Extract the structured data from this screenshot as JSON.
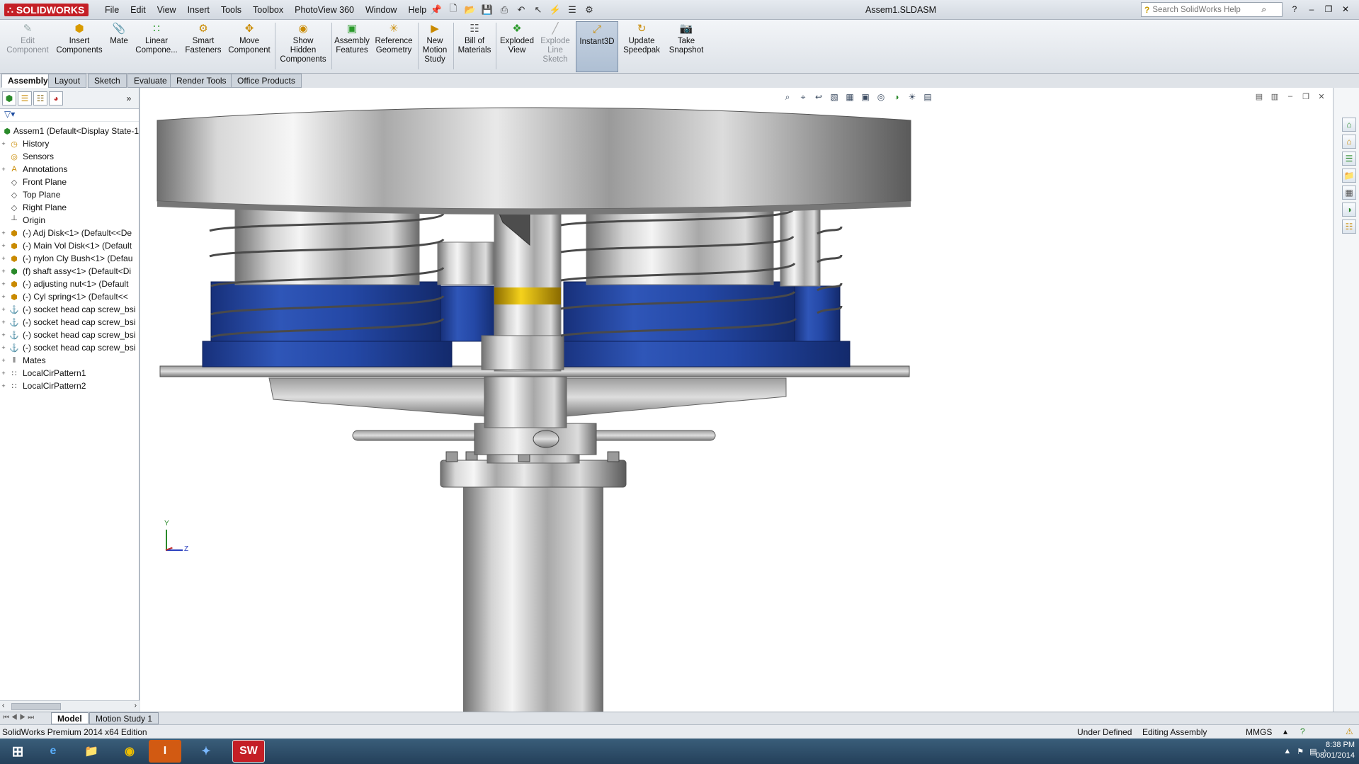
{
  "app": {
    "logo_text": "SOLIDWORKS",
    "document_title": "Assem1.SLDASM"
  },
  "menu": [
    "File",
    "Edit",
    "View",
    "Insert",
    "Tools",
    "Toolbox",
    "PhotoView 360",
    "Window",
    "Help"
  ],
  "search": {
    "placeholder": "Search SolidWorks Help"
  },
  "command_manager": {
    "edit_component": "Edit\nComponent",
    "insert_components": "Insert\nComponents",
    "mate": "Mate",
    "linear_component": "Linear\nCompone...",
    "smart_fasteners": "Smart\nFasteners",
    "move_component": "Move\nComponent",
    "show_hidden": "Show\nHidden\nComponents",
    "assembly_features": "Assembly\nFeatures",
    "reference_geometry": "Reference\nGeometry",
    "new_motion_study": "New\nMotion\nStudy",
    "bill_of_materials": "Bill of\nMaterials",
    "exploded_view": "Exploded\nView",
    "explode_line_sketch": "Explode\nLine\nSketch",
    "instant3d": "Instant3D",
    "update_speedpak": "Update\nSpeedpak",
    "take_snapshot": "Take\nSnapshot"
  },
  "tabs": [
    "Assembly",
    "Layout",
    "Sketch",
    "Evaluate",
    "Render Tools",
    "Office Products"
  ],
  "tree": [
    {
      "label": "Assem1  (Default<Display State-1",
      "icon": "assembly-icon",
      "exp": ""
    },
    {
      "label": "History",
      "icon": "history-icon",
      "exp": "+"
    },
    {
      "label": "Sensors",
      "icon": "sensors-icon",
      "exp": ""
    },
    {
      "label": "Annotations",
      "icon": "annotations-icon",
      "exp": "+"
    },
    {
      "label": "Front Plane",
      "icon": "plane-icon",
      "exp": ""
    },
    {
      "label": "Top Plane",
      "icon": "plane-icon",
      "exp": ""
    },
    {
      "label": "Right Plane",
      "icon": "plane-icon",
      "exp": ""
    },
    {
      "label": "Origin",
      "icon": "origin-icon",
      "exp": ""
    },
    {
      "label": "(-) Adj Disk<1> (Default<<De",
      "icon": "part-icon",
      "exp": "+"
    },
    {
      "label": "(-) Main Vol Disk<1> (Default",
      "icon": "part-icon",
      "exp": "+"
    },
    {
      "label": "(-) nylon Cly Bush<1> (Defau",
      "icon": "part-icon",
      "exp": "+"
    },
    {
      "label": "(f) shaft assy<1> (Default<Di",
      "icon": "subassembly-icon",
      "exp": "+"
    },
    {
      "label": "(-) adjusting nut<1> (Default",
      "icon": "part-icon",
      "exp": "+"
    },
    {
      "label": "(-) Cyl spring<1> (Default<<",
      "icon": "part-icon",
      "exp": "+"
    },
    {
      "label": "(-) socket head cap screw_bsi",
      "icon": "screw-icon",
      "exp": "+"
    },
    {
      "label": "(-) socket head cap screw_bsi",
      "icon": "screw-icon",
      "exp": "+"
    },
    {
      "label": "(-) socket head cap screw_bsi",
      "icon": "screw-icon",
      "exp": "+"
    },
    {
      "label": "(-) socket head cap screw_bsi",
      "icon": "screw-icon",
      "exp": "+"
    },
    {
      "label": "Mates",
      "icon": "mates-icon",
      "exp": "+"
    },
    {
      "label": "LocalCirPattern1",
      "icon": "pattern-icon",
      "exp": "+"
    },
    {
      "label": "LocalCirPattern2",
      "icon": "pattern-icon",
      "exp": "+"
    }
  ],
  "triad": {
    "y": "Y",
    "z": "Z"
  },
  "bottom_tabs": [
    "Model",
    "Motion Study 1"
  ],
  "status": {
    "edition": "SolidWorks Premium 2014 x64 Edition",
    "definition": "Under Defined",
    "mode": "Editing Assembly",
    "units": "MMGS"
  },
  "taskbar": {
    "time": "8:38 PM",
    "date": "08/01/2014"
  }
}
